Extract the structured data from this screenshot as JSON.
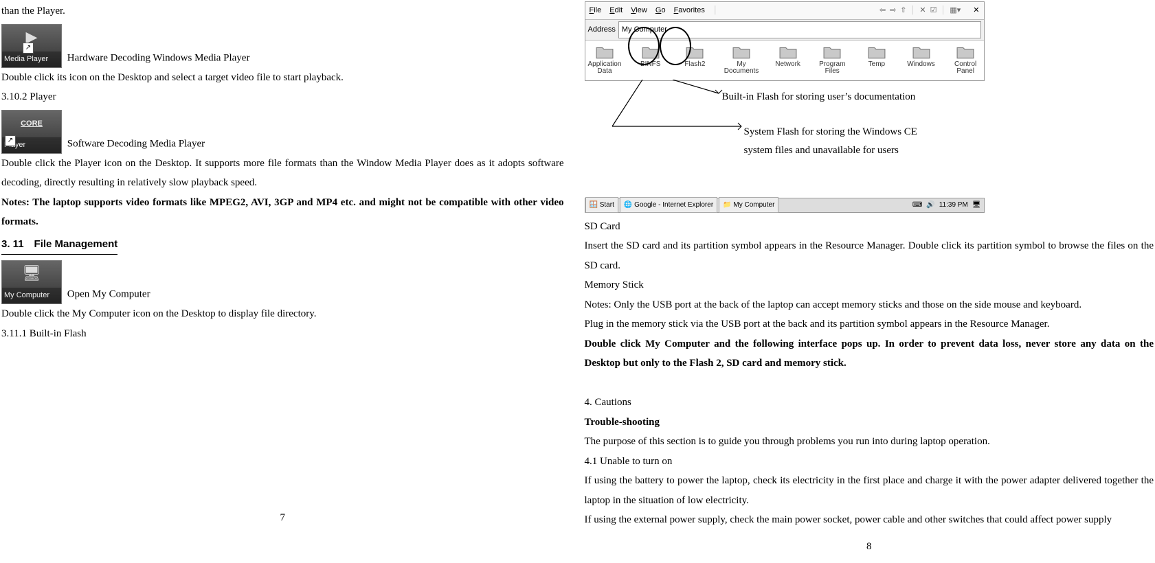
{
  "left": {
    "line_top": "than the Player.",
    "media_player_icon_label": "Media Player",
    "hw_decode": "Hardware Decoding Windows Media Player",
    "dbl_icon": "Double click its icon on the Desktop and select a target video file to start playback.",
    "s3102": "3.10.2 Player",
    "player_icon_label": "Player",
    "sw_decode": "Software Decoding Media Player",
    "sw_para": "Double click the Player icon on the Desktop. It supports more file formats than the Window Media Player does as it adopts software decoding, directly resulting in relatively slow playback speed.",
    "notes_bold": "Notes: The laptop supports video formats like MPEG2, AVI, 3GP and MP4 etc. and might not be compatible with other video formats.",
    "s311": "3. 11 File Management",
    "mycomp_icon_label": "My Computer",
    "open_mycomp": "Open My Computer",
    "dbl_mycomp": "Double click the My Computer icon on the Desktop to display file directory.",
    "s3111": "3.11.1 Built-in Flash",
    "page_no": "7"
  },
  "right": {
    "menus": {
      "file": "File",
      "edit": "Edit",
      "view": "View",
      "go": "Go",
      "fav": "Favorites"
    },
    "address_label": "Address",
    "address_value": "My Computer",
    "folders": [
      {
        "name": "Application Data"
      },
      {
        "name": "BINFS"
      },
      {
        "name": "Flash2"
      },
      {
        "name": "My Documents"
      },
      {
        "name": "Network"
      },
      {
        "name": "Program Files"
      },
      {
        "name": "Temp"
      },
      {
        "name": "Windows"
      },
      {
        "name": "Control Panel"
      }
    ],
    "ann_flash2": "Built-in Flash for storing user’s documentation",
    "ann_binfs_1": "System Flash for storing the Windows CE",
    "ann_binfs_2": "system files and unavailable for users",
    "taskbar": {
      "start": "Start",
      "task1": "Google - Internet Explorer",
      "task2": "My Computer",
      "time": "11:39 PM"
    },
    "sd_card_h": "SD Card",
    "sd_card_p": "Insert the SD card and its partition symbol appears in the Resource Manager. Double click its partition symbol to browse the files on the SD card.",
    "mem_h": "Memory Stick",
    "mem_notes": "Notes: Only the USB port at the back of the laptop can accept memory sticks and those on the side mouse and keyboard.",
    "mem_plug": "Plug in the memory stick via the USB port at the back and its partition symbol appears in the Resource Manager.",
    "mem_bold": "Double click My Computer and the following interface pops up. In order to prevent data loss, never store any data on the Desktop but only to the Flash 2, SD card and memory stick.",
    "s4": "4. Cautions",
    "trouble_h": "Trouble-shooting",
    "trouble_p": "The purpose of this section is to guide you through problems you run into during laptop operation.",
    "s41": "4.1 Unable to turn on",
    "s41_p1": "If using the battery to power the laptop, check its electricity in the first place and charge it with the power adapter delivered together the laptop in the situation of low electricity.",
    "s41_p2": "If using the external power supply, check the main power socket, power cable and other switches that could affect power supply",
    "page_no": "8"
  }
}
